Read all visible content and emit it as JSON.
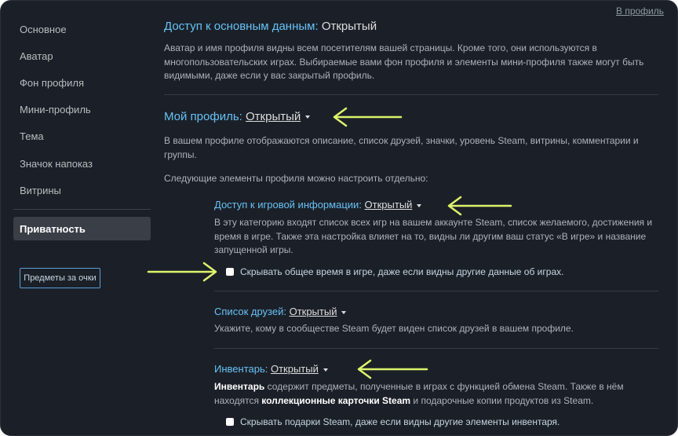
{
  "back_link": "В профиль",
  "sidebar": {
    "items": [
      {
        "label": "Основное"
      },
      {
        "label": "Аватар"
      },
      {
        "label": "Фон профиля"
      },
      {
        "label": "Мини-профиль"
      },
      {
        "label": "Тема"
      },
      {
        "label": "Значок напоказ"
      },
      {
        "label": "Витрины"
      }
    ],
    "active_label": "Приватность",
    "button_label": "Предметы за очки"
  },
  "basic": {
    "title": "Доступ к основным данным:",
    "value": "Открытый",
    "description": "Аватар и имя профиля видны всем посетителям вашей страницы. Кроме того, они используются в многопользовательских играх. Выбираемые вами фон профиля и элементы мини-профиля также могут быть видимыми, даже если у вас закрытый профиль."
  },
  "my_profile": {
    "title": "Мой профиль:",
    "value": "Открытый",
    "description": "В вашем профиле отображаются описание, список друзей, значки, уровень Steam, витрины, комментарии и группы.",
    "note": "Следующие элементы профиля можно настроить отдельно:"
  },
  "game_details": {
    "title": "Доступ к игровой информации:",
    "value": "Открытый",
    "description": "В эту категорию входят список всех игр на вашем аккаунте Steam, список желаемого, достижения и время в игре. Также эта настройка влияет на то, видны ли другим ваш статус «В игре» и название запущенной игры.",
    "checkbox_label": "Скрывать общее время в игре, даже если видны другие данные об играх."
  },
  "friends": {
    "title": "Список друзей:",
    "value": "Открытый",
    "description": "Укажите, кому в сообществе Steam будет виден список друзей в вашем профиле."
  },
  "inventory": {
    "title": "Инвентарь:",
    "value": "Открытый",
    "desc_bold1": "Инвентарь",
    "desc_part1": " содержит предметы, полученные в играх с функцией обмена Steam. Также в нём находятся ",
    "desc_bold2": "коллекционные карточки Steam",
    "desc_part2": " и подарочные копии продуктов из Steam.",
    "checkbox_label": "Скрывать подарки Steam, даже если видны другие элементы инвентаря."
  },
  "colors": {
    "background": "#1b2028",
    "heading": "#67c1f5",
    "annotation_arrow": "#dcf36b"
  }
}
